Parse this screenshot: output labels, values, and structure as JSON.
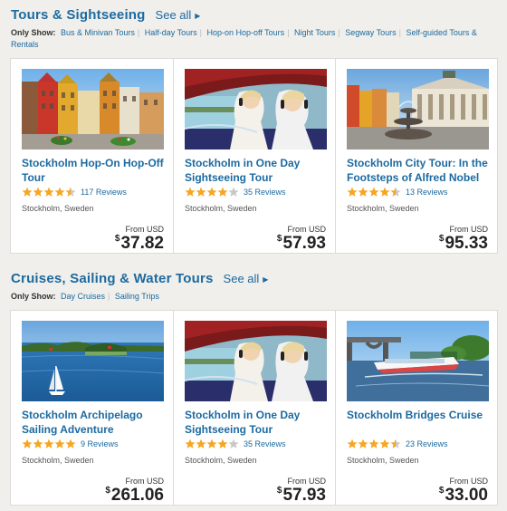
{
  "colors": {
    "link": "#1c6aa0",
    "star": "#f5a623",
    "background": "#f0efeb"
  },
  "sections": [
    {
      "title": "Tours & Sightseeing",
      "see_all": "See all",
      "only_show_label": "Only Show:",
      "filters": [
        "Bus & Minivan Tours",
        "Half-day Tours",
        "Hop-on Hop-off Tours",
        "Night Tours",
        "Segway Tours",
        "Self-guided Tours & Rentals"
      ],
      "cards": [
        {
          "title": "Stockholm Hop-On Hop-Off Tour",
          "rating": 4.5,
          "reviews": "117 Reviews",
          "location": "Stockholm, Sweden",
          "from": "From USD",
          "currency": "$",
          "price": "37.82",
          "image": "colorful-old-town-buildings"
        },
        {
          "title": "Stockholm in One Day Sightseeing Tour",
          "rating": 4,
          "reviews": "35 Reviews",
          "location": "Stockholm, Sweden",
          "from": "From USD",
          "currency": "$",
          "price": "57.93",
          "image": "tourists-on-bus"
        },
        {
          "title": "Stockholm City Tour: In the Footsteps of Alfred Nobel",
          "rating": 4.5,
          "reviews": "13 Reviews",
          "location": "Stockholm, Sweden",
          "from": "From USD",
          "currency": "$",
          "price": "95.33",
          "image": "old-town-square-fountain"
        }
      ]
    },
    {
      "title": "Cruises, Sailing & Water Tours",
      "see_all": "See all",
      "only_show_label": "Only Show:",
      "filters": [
        "Day Cruises",
        "Sailing Trips"
      ],
      "cards": [
        {
          "title": "Stockholm Archipelago Sailing Adventure",
          "rating": 5,
          "reviews": "9 Reviews",
          "location": "Stockholm, Sweden",
          "from": "From USD",
          "currency": "$",
          "price": "261.06",
          "image": "sailboat-archipelago"
        },
        {
          "title": "Stockholm in One Day Sightseeing Tour",
          "rating": 4,
          "reviews": "35 Reviews",
          "location": "Stockholm, Sweden",
          "from": "From USD",
          "currency": "$",
          "price": "57.93",
          "image": "tourists-on-bus"
        },
        {
          "title": "Stockholm Bridges Cruise",
          "rating": 4.5,
          "reviews": "23 Reviews",
          "location": "Stockholm, Sweden",
          "from": "From USD",
          "currency": "$",
          "price": "33.00",
          "image": "boat-under-bridge"
        }
      ]
    }
  ]
}
